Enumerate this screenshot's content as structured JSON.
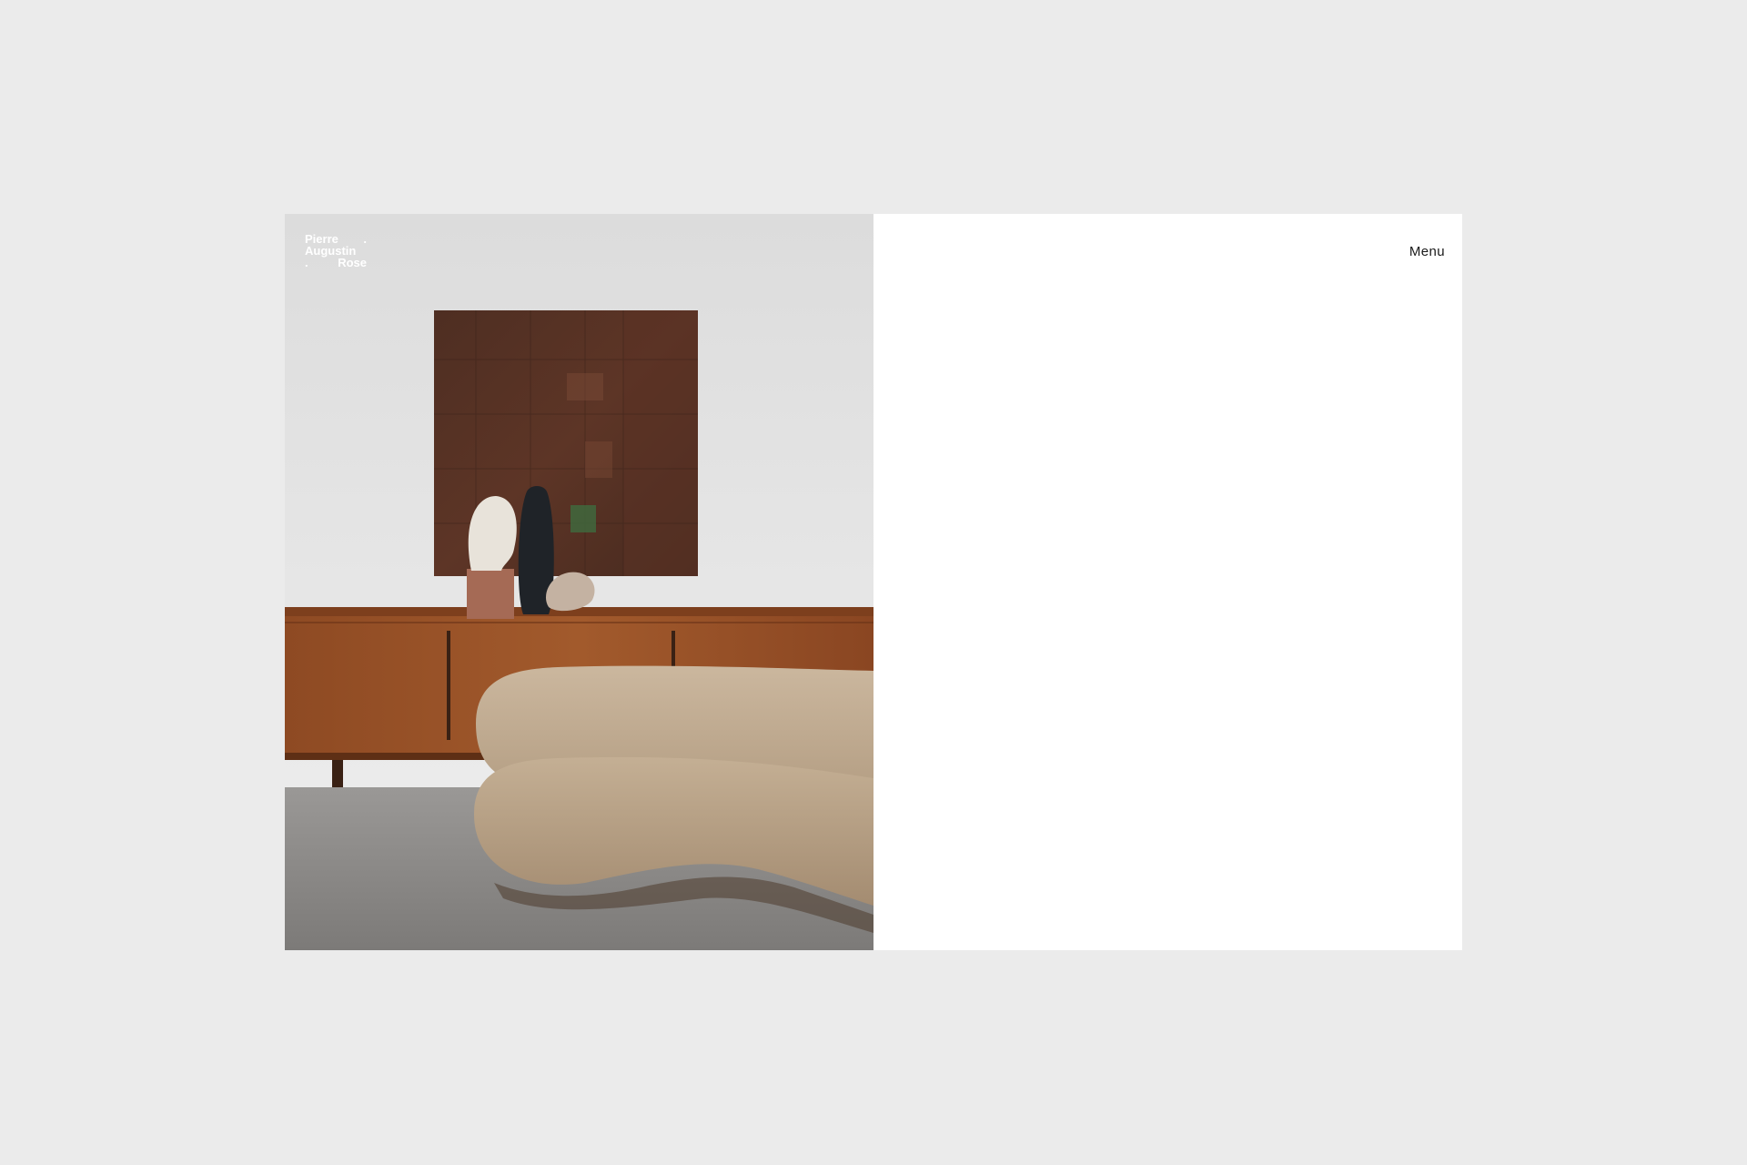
{
  "brand": {
    "line1": "Pierre",
    "line1_mark": ".",
    "line2": "Augustin",
    "line3_mark": ".",
    "line3": "Rose"
  },
  "header": {
    "menu_label": "Menu"
  },
  "hero": {
    "image_subject": "interior-photo-sofa-sideboard-artwork"
  },
  "colors": {
    "page_background": "#ebebeb",
    "panel_background": "#ffffff",
    "text": "#1a1a1a"
  }
}
